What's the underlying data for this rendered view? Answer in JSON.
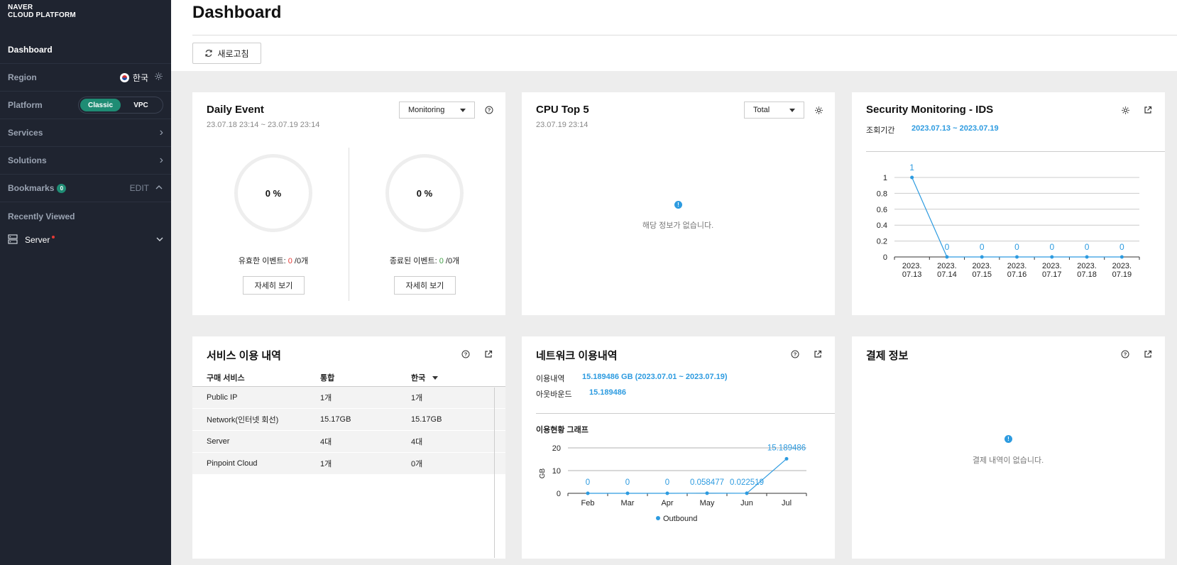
{
  "sidebar": {
    "logo_line1": "NAVER",
    "logo_line2": "CLOUD PLATFORM",
    "dashboard": "Dashboard",
    "region_label": "Region",
    "region_value": "한국",
    "platform_label": "Platform",
    "platform_options": [
      "Classic",
      "VPC"
    ],
    "platform_selected": "Classic",
    "services": "Services",
    "solutions": "Solutions",
    "bookmarks": "Bookmarks",
    "bookmarks_count": "0",
    "edit": "EDIT",
    "recently_viewed": "Recently Viewed",
    "recent_items": [
      {
        "label": "Server"
      }
    ]
  },
  "header": {
    "title": "Dashboard",
    "refresh": "새로고침"
  },
  "daily_event": {
    "title": "Daily Event",
    "period": "23.07.18 23:14 ~ 23.07.19 23:14",
    "select": "Monitoring",
    "valid": {
      "percent": "0 %",
      "label": "유효한 이벤트: ",
      "count": "0",
      "total": " /0개",
      "button": "자세히 보기"
    },
    "ended": {
      "percent": "0 %",
      "label": "종료된 이벤트: ",
      "count": "0",
      "total": " /0개",
      "button": "자세히 보기"
    }
  },
  "cpu": {
    "title": "CPU Top 5",
    "time": "23.07.19 23:14",
    "select": "Total",
    "empty": "해당 정보가 없습니다."
  },
  "security": {
    "title": "Security Monitoring - IDS",
    "period_label": "조회기간",
    "period_value": "2023.07.13 ~ 2023.07.19"
  },
  "service_usage": {
    "title": "서비스 이용 내역",
    "columns": [
      "구매 서비스",
      "통합",
      "한국"
    ],
    "rows": [
      [
        "Public IP",
        "1개",
        "1개"
      ],
      [
        "Network(인터넷 회선)",
        "15.17GB",
        "15.17GB"
      ],
      [
        "Server",
        "4대",
        "4대"
      ],
      [
        "Pinpoint Cloud",
        "1개",
        "0개"
      ]
    ]
  },
  "network": {
    "title": "네트워크 이용내역",
    "usage_label": "이용내역",
    "usage_value": "15.189486 GB (2023.07.01 ~ 2023.07.19)",
    "outbound_label": "아웃바운드",
    "outbound_value": "15.189486",
    "graph_title": "이용현황 그래프"
  },
  "billing": {
    "title": "결제 정보",
    "empty": "결제 내역이 없습니다."
  },
  "colors": {
    "accent": "#2d9be0",
    "sidebar": "#1f2430",
    "toggle_on": "#1f8c74"
  },
  "chart_data": [
    {
      "type": "line",
      "x": [
        "2023.07.13",
        "2023.07.14",
        "2023.07.15",
        "2023.07.16",
        "2023.07.17",
        "2023.07.18",
        "2023.07.19"
      ],
      "y": [
        1,
        0,
        0,
        0,
        0,
        0,
        0
      ],
      "labels": [
        "1",
        "0",
        "0",
        "0",
        "0",
        "0",
        "0"
      ],
      "yticks": [
        "0",
        "0.2",
        "0.4",
        "0.6",
        "0.8",
        "1"
      ],
      "ylim": [
        0,
        1
      ],
      "grid": true
    },
    {
      "type": "line",
      "x": [
        "Feb",
        "Mar",
        "Apr",
        "May",
        "Jun",
        "Jul"
      ],
      "y": [
        0,
        0,
        0,
        0.058477,
        0.022519,
        15.189486
      ],
      "labels": [
        "0",
        "0",
        "0",
        "0.058477",
        "0.022519",
        "15.189486"
      ],
      "yticks": [
        "0",
        "10",
        "20"
      ],
      "ylim": [
        0,
        20
      ],
      "ylabel": "GB",
      "legend": "Outbound",
      "legend_position": "bottom",
      "grid": true
    }
  ]
}
